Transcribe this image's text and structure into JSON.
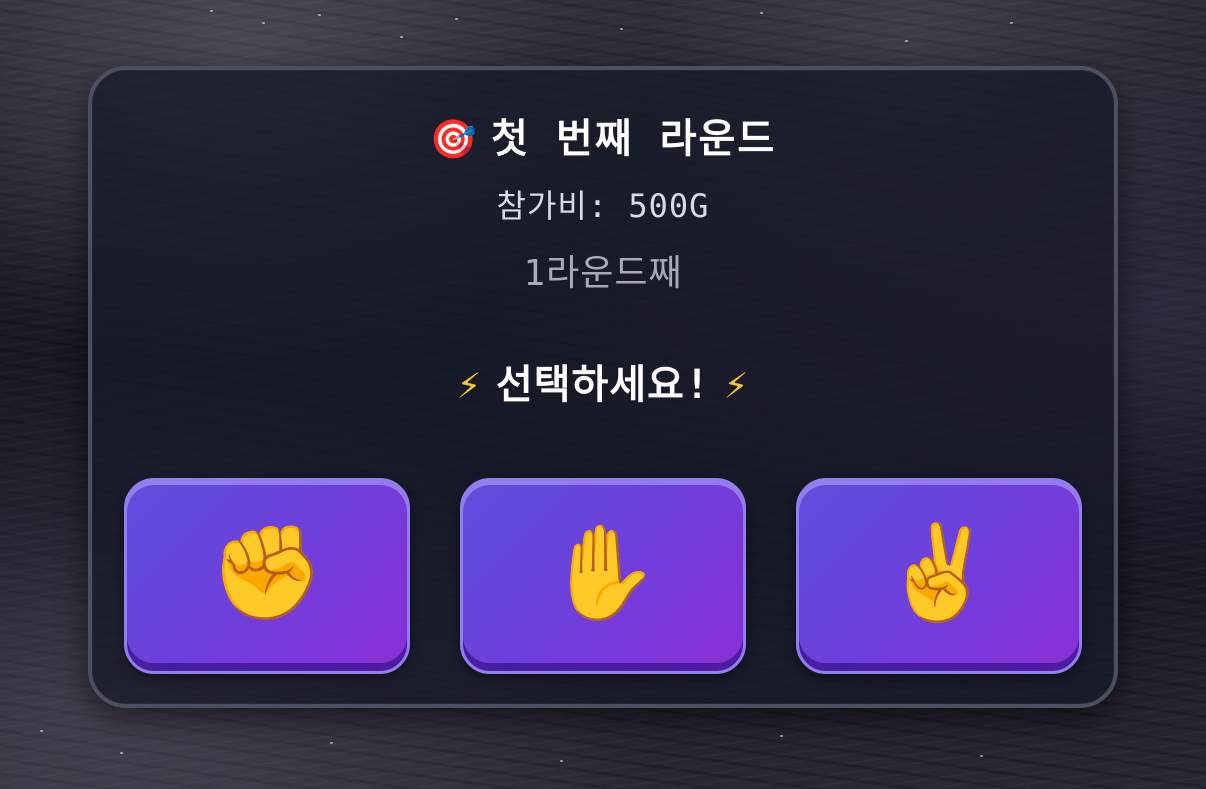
{
  "header": {
    "icon": "🎯",
    "icon_name": "dart-target-icon",
    "title": "첫 번째 라운드"
  },
  "entry_fee": "참가비: 500G",
  "round_label": "1라운드째",
  "prompt": {
    "bolt_left": "⚡",
    "text": "선택하세요!",
    "bolt_right": "⚡"
  },
  "choices": [
    {
      "id": "rock",
      "icon": "✊",
      "icon_name": "fist-icon"
    },
    {
      "id": "paper",
      "icon": "✋",
      "icon_name": "open-hand-icon"
    },
    {
      "id": "scissors",
      "icon": "✌️",
      "icon_name": "victory-hand-icon"
    }
  ],
  "colors": {
    "button_gradient_start": "#5e4fdc",
    "button_gradient_end": "#8b2fd8",
    "button_border": "#8f7ff0",
    "card_border": "#4b4f5e",
    "bolt": "#f7c531"
  }
}
